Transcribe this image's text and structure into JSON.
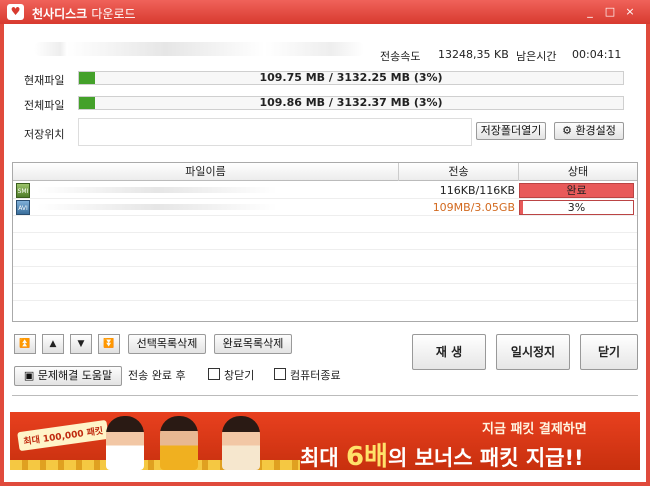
{
  "title": {
    "app_name": "천사디스크",
    "sub_name": "다운로드",
    "min": "_",
    "max": "□",
    "close": "×"
  },
  "info": {
    "speed_label": "전송속도",
    "speed_value": "13248,35 KB",
    "remain_label": "남은시간",
    "remain_value": "00:04:11",
    "current_label": "현재파일",
    "current_text": "109.75 MB / 3132.25 MB (3%)",
    "current_progress": 0.03,
    "total_label": "전체파일",
    "total_text": "109.86 MB / 3132.37 MB (3%)",
    "total_progress": 0.03,
    "path_label": "저장위치",
    "open_folder": "저장폴더열기",
    "settings": "환경설정"
  },
  "list": {
    "headers": [
      "파일이름",
      "전송",
      "상태"
    ],
    "rows": [
      {
        "icon": "SMI",
        "transfer": "116KB/116KB",
        "status": "완료",
        "progress": 1.0,
        "transfer_color": "#222222"
      },
      {
        "icon": "AVI",
        "transfer": "109MB/3.05GB",
        "status": "3%",
        "progress": 0.03,
        "transfer_color": "#d2691e"
      }
    ]
  },
  "controls": {
    "delete_selected": "선택목록삭제",
    "delete_completed": "완료목록삭제",
    "play": "재 생",
    "pause": "일시정지",
    "close": "닫기",
    "help": "문제해결 도움말",
    "after_label": "전송 완료 후",
    "close_window": "창닫기",
    "shutdown": "컴퓨터종료"
  },
  "banner": {
    "tag": "최대 100,000 패킷",
    "line1": "지금 패킷 결제하면",
    "prefix": "최대 ",
    "emphasis": "6배",
    "suffix": "의 보너스 패킷 지급!!"
  },
  "colors": {
    "titlebar": "#e04a3c",
    "progress": "#44a12a",
    "status_fill": "#e85a5a",
    "banner": "#d83a18"
  }
}
